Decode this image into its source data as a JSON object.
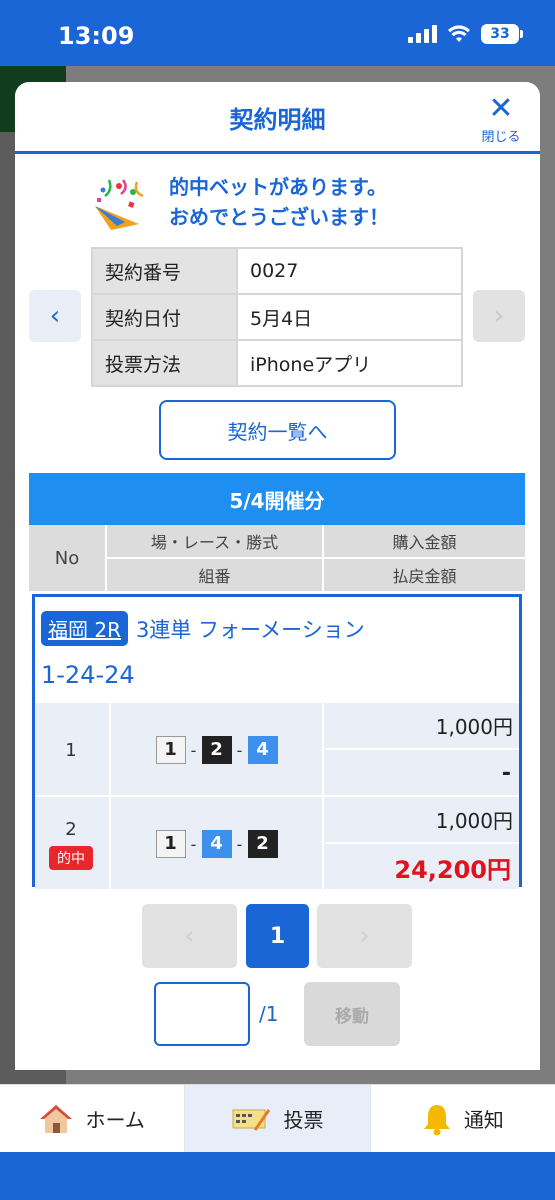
{
  "status": {
    "time": "13:09",
    "battery": "33"
  },
  "modal": {
    "title": "契約明細",
    "close_label": "閉じる",
    "congrats_line1": "的中ベットがあります。",
    "congrats_line2": "おめでとうございます！",
    "info": [
      {
        "key": "契約番号",
        "value": "0027"
      },
      {
        "key": "契約日付",
        "value": "5月4日"
      },
      {
        "key": "投票方法",
        "value": "iPhoneアプリ"
      }
    ],
    "list_button": "契約一覧へ",
    "session": "5/4開催分",
    "headers": {
      "no": "No",
      "race": "場・レース・勝式",
      "buy": "購入金額",
      "combo": "組番",
      "payout": "払戻金額"
    },
    "bet": {
      "venue": "福岡 2R",
      "type": "3連単 フォーメーション",
      "formation": "1-24-24",
      "rows": [
        {
          "no": "1",
          "hit": "",
          "combo": [
            "1",
            "2",
            "4"
          ],
          "buy": "1,000円",
          "payout": "-"
        },
        {
          "no": "2",
          "hit": "的中",
          "combo": [
            "1",
            "4",
            "2"
          ],
          "buy": "1,000円",
          "payout": "24,200円"
        }
      ]
    },
    "pager": {
      "prev": "‹",
      "current": "1",
      "next": "›",
      "total": "/1",
      "move": "移動",
      "input_value": ""
    }
  },
  "tabbar": {
    "home": "ホーム",
    "vote": "投票",
    "notify": "通知"
  },
  "colors": {
    "brand": "#1a66d6",
    "win": "#e0121d",
    "session": "#1e8ff0"
  }
}
